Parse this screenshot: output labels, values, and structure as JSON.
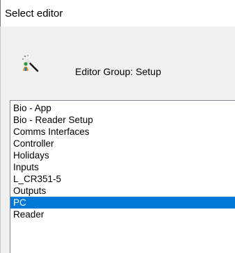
{
  "window": {
    "title": "Select editor"
  },
  "header": {
    "icon": "magic-wand-icon",
    "group_label": "Editor Group: Setup"
  },
  "list": {
    "items": [
      {
        "label": "Bio - App",
        "selected": false
      },
      {
        "label": "Bio - Reader Setup",
        "selected": false
      },
      {
        "label": "Comms Interfaces",
        "selected": false
      },
      {
        "label": "Controller",
        "selected": false
      },
      {
        "label": "Holidays",
        "selected": false
      },
      {
        "label": "Inputs",
        "selected": false
      },
      {
        "label": "L_CR351-5",
        "selected": false
      },
      {
        "label": "Outputs",
        "selected": false
      },
      {
        "label": "PC",
        "selected": true
      },
      {
        "label": "Reader",
        "selected": false
      }
    ]
  },
  "colors": {
    "selection": "#0078d7",
    "selection_text": "#ffffff"
  }
}
